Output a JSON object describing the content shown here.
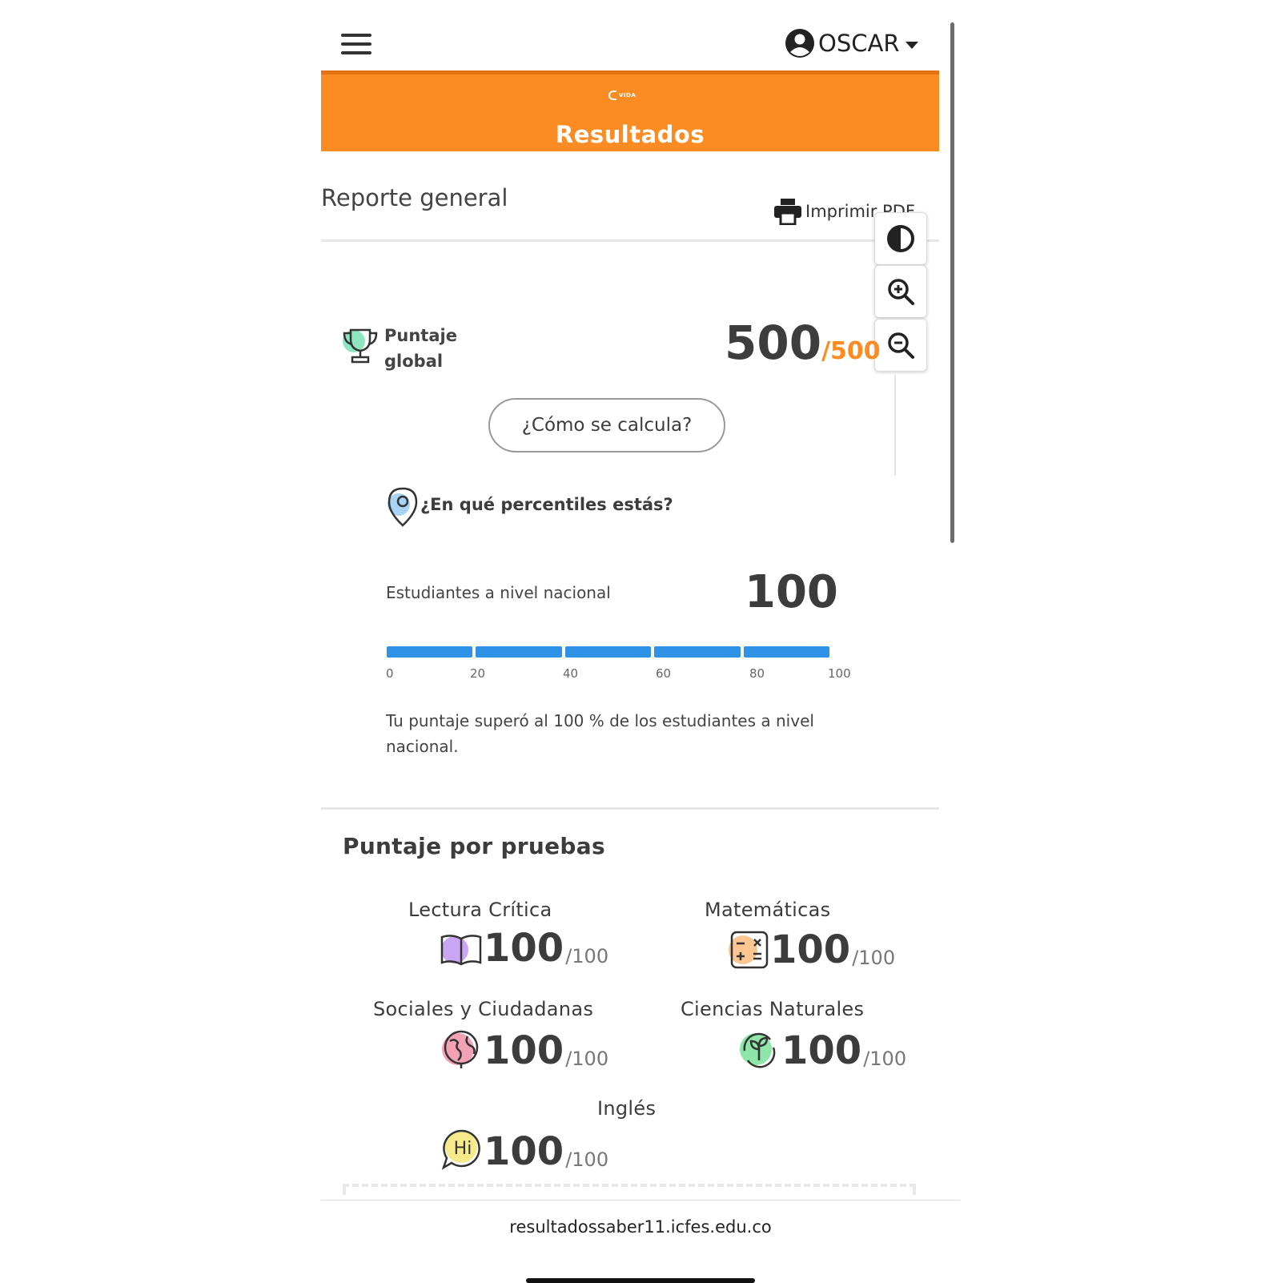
{
  "header": {
    "user_name": "OSCAR"
  },
  "banner": {
    "logo_text": "VIDA",
    "title": "Resultados"
  },
  "report": {
    "title": "Reporte general",
    "print_label": "Imprimir PDF",
    "global_label_line1": "Puntaje",
    "global_label_line2": "global",
    "global_score": "500",
    "global_max": "/500",
    "how_button": "¿Cómo se calcula?"
  },
  "percentiles": {
    "title": "¿En qué percentiles estás?",
    "national_label": "Estudiantes a nivel nacional",
    "national_value": "100",
    "progress_fraction": 1.0,
    "ticks": [
      "0",
      "20",
      "40",
      "60",
      "80",
      "100"
    ],
    "description": "Tu puntaje superó al 100 % de los estudiantes a nivel nacional."
  },
  "tests": {
    "title": "Puntaje por pruebas",
    "items": [
      {
        "name": "Lectura Crítica",
        "score": "100",
        "max": "/100",
        "icon": "book-icon"
      },
      {
        "name": "Matemáticas",
        "score": "100",
        "max": "/100",
        "icon": "calculator-icon"
      },
      {
        "name": "Sociales y Ciudadanas",
        "score": "100",
        "max": "/100",
        "icon": "globe-icon"
      },
      {
        "name": "Ciencias Naturales",
        "score": "100",
        "max": "/100",
        "icon": "plant-icon"
      },
      {
        "name": "Inglés",
        "score": "100",
        "max": "/100",
        "icon": "speech-bubble-icon",
        "icon_text": "Hi"
      }
    ]
  },
  "browser": {
    "url": "resultadossaber11.icfes.edu.co"
  },
  "colors": {
    "accent": "#fb8c24",
    "progress": "#2e93e6"
  }
}
